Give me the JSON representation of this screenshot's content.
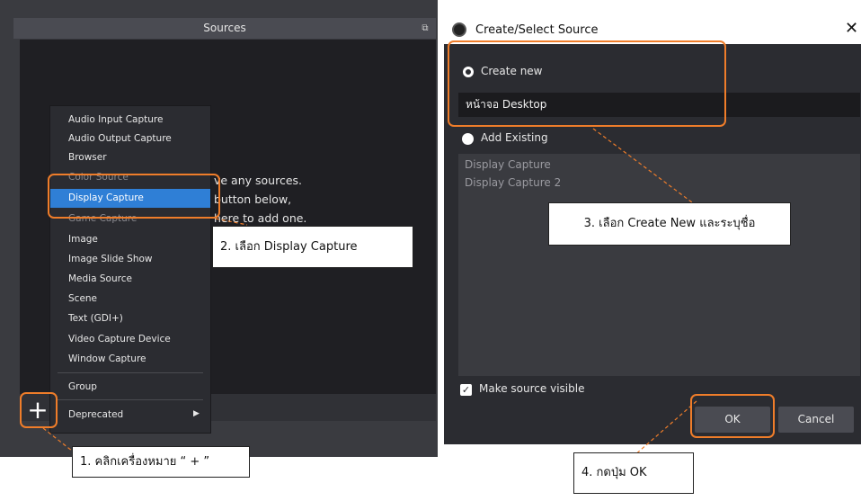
{
  "sources_panel": {
    "title": "Sources",
    "float_icon": "float-icon",
    "empty_text": "ve any sources.\nbutton below,\nhere to add one.",
    "add_button": "+"
  },
  "context_menu": {
    "items": [
      {
        "label": "Audio Input Capture"
      },
      {
        "label": "Audio Output Capture"
      },
      {
        "label": "Browser"
      },
      {
        "label": "Color Source"
      },
      {
        "label": "Display Capture"
      },
      {
        "label": "Game Capture"
      },
      {
        "label": "Image"
      },
      {
        "label": "Image Slide Show"
      },
      {
        "label": "Media Source"
      },
      {
        "label": "Scene"
      },
      {
        "label": "Text (GDI+)"
      },
      {
        "label": "Video Capture Device"
      },
      {
        "label": "Window Capture"
      },
      {
        "label": "Group"
      },
      {
        "label": "Deprecated"
      }
    ],
    "selected": "Display Capture"
  },
  "dialog": {
    "title": "Create/Select Source",
    "close": "✕",
    "create_new_label": "Create new",
    "name_value": "หน้าจอ Desktop",
    "add_existing_label": "Add Existing",
    "existing_items": [
      "Display Capture",
      "Display Capture 2"
    ],
    "make_visible_label": "Make source visible",
    "make_visible_checked": true,
    "ok_label": "OK",
    "cancel_label": "Cancel"
  },
  "callouts": {
    "step1": "1. คลิกเครื่องหมาย “ + ”",
    "step2": "2. เลือก Display Capture",
    "step3": "3. เลือก Create New และระบุชื่อ",
    "step4": "4. กดปุ่ม OK"
  },
  "colors": {
    "highlight": "#ef7d2a",
    "selected_item": "#2f7fd6",
    "panel_bg": "#3a3b40"
  }
}
